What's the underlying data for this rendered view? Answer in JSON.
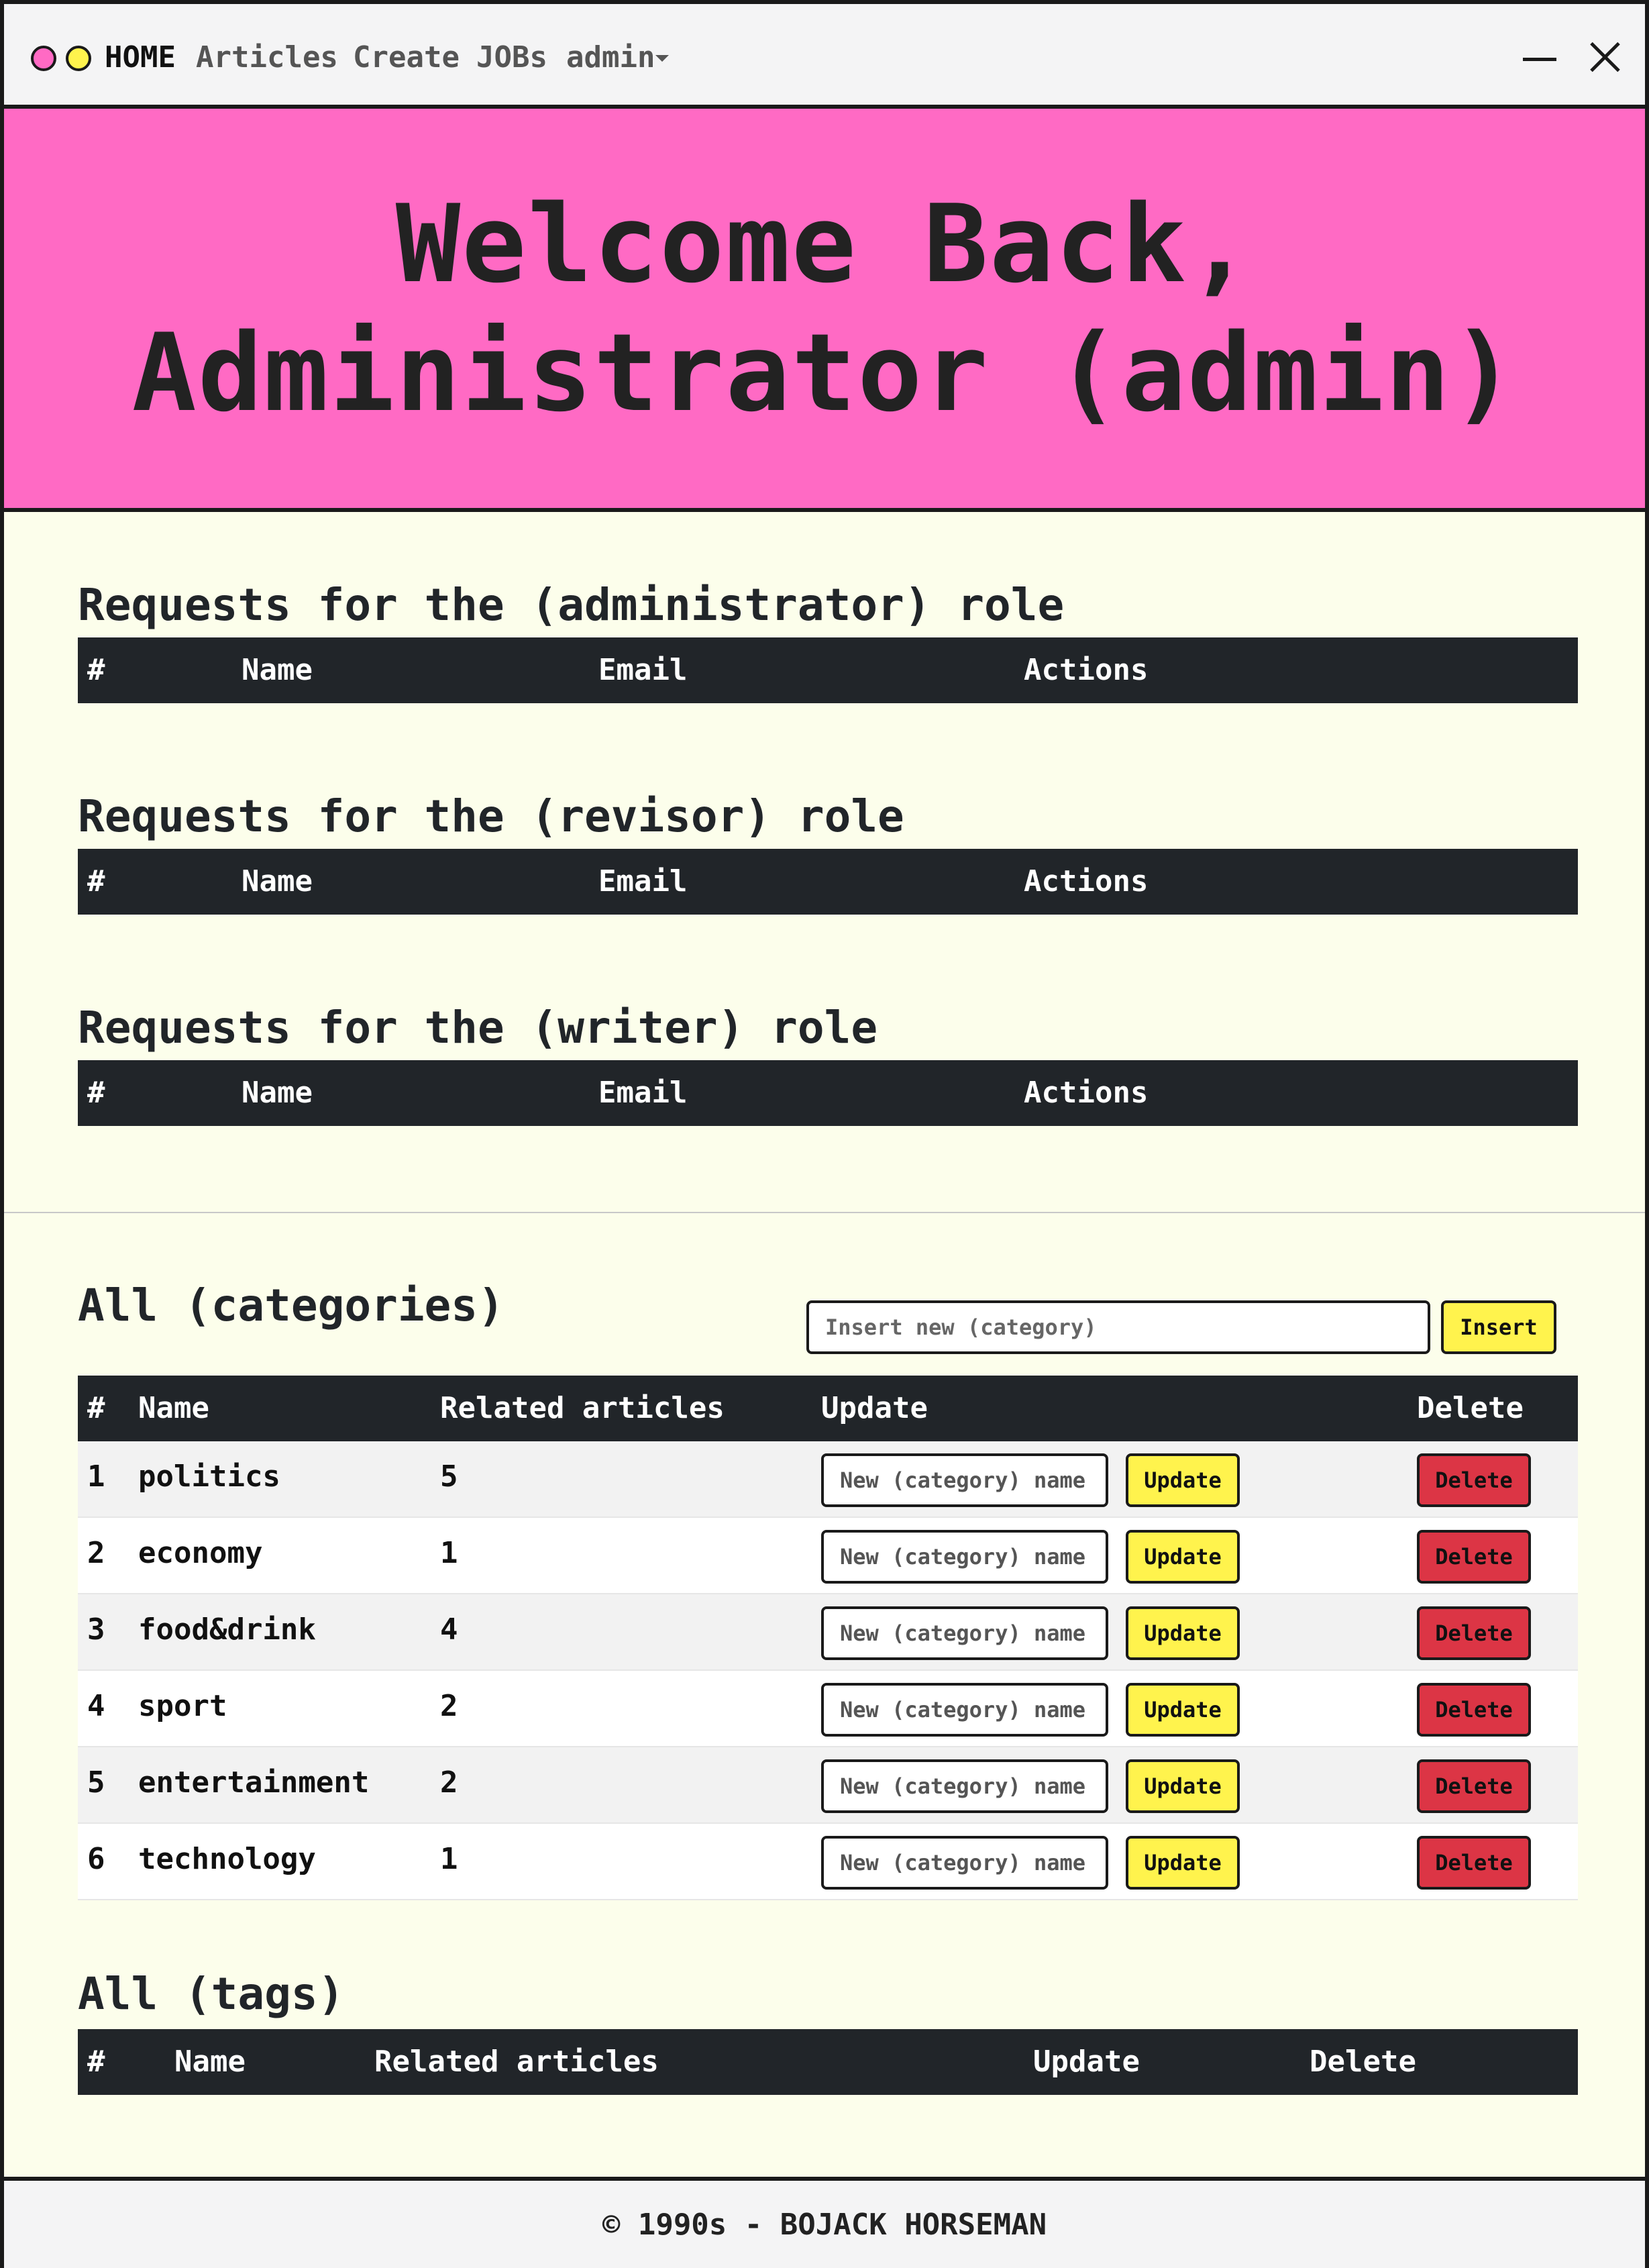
{
  "navbar": {
    "links": [
      "HOME",
      "Articles",
      "Create",
      "JOBs",
      "admin"
    ]
  },
  "hero": {
    "line1": "Welcome Back,",
    "line2": "Administrator (admin)"
  },
  "requests": [
    {
      "heading": "Requests for the (administrator) role",
      "columns": [
        "#",
        "Name",
        "Email",
        "Actions"
      ]
    },
    {
      "heading": "Requests for the (revisor) role",
      "columns": [
        "#",
        "Name",
        "Email",
        "Actions"
      ]
    },
    {
      "heading": "Requests for the (writer) role",
      "columns": [
        "#",
        "Name",
        "Email",
        "Actions"
      ]
    }
  ],
  "categories": {
    "heading": "All (categories)",
    "insert_placeholder": "Insert new (category)",
    "insert_label": "Insert",
    "columns": [
      "#",
      "Name",
      "Related articles",
      "Update",
      "Delete"
    ],
    "update_placeholder": "New (category) name",
    "update_label": "Update",
    "delete_label": "Delete",
    "rows": [
      {
        "id": "1",
        "name": "politics",
        "related": "5"
      },
      {
        "id": "2",
        "name": "economy",
        "related": "1"
      },
      {
        "id": "3",
        "name": "food&drink",
        "related": "4"
      },
      {
        "id": "4",
        "name": "sport",
        "related": "2"
      },
      {
        "id": "5",
        "name": "entertainment",
        "related": "2"
      },
      {
        "id": "6",
        "name": "technology",
        "related": "1"
      }
    ]
  },
  "tags": {
    "heading": "All (tags)",
    "columns": [
      "#",
      "Name",
      "Related articles",
      "Update",
      "Delete"
    ]
  },
  "footer": {
    "text": "© 1990s - BOJACK HORSEMAN"
  }
}
